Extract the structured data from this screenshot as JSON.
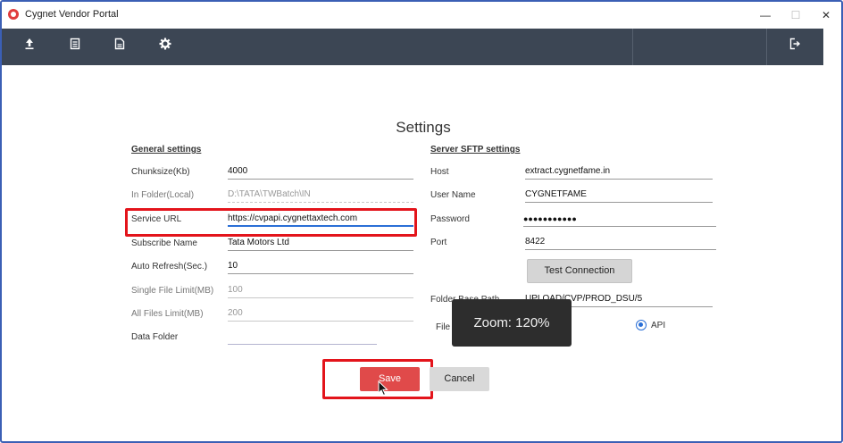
{
  "window": {
    "title": "Cygnet Vendor Portal",
    "minimize_glyph": "—",
    "maximize_glyph": "☐",
    "close_glyph": "✕"
  },
  "toolbar": {
    "buttons": [
      {
        "icon": "upload-icon"
      },
      {
        "icon": "list-document-icon"
      },
      {
        "icon": "file-document-icon"
      },
      {
        "icon": "gear-icon"
      },
      {
        "icon": "logout-icon"
      }
    ],
    "background": "#3c4654"
  },
  "settings": {
    "title": "Settings",
    "general": {
      "heading": "General settings",
      "chunksize_label": "Chunksize(Kb)",
      "chunksize_value": "4000",
      "in_folder_label": "In Folder(Local)",
      "in_folder_value": "D:\\TATA\\TWBatch\\IN",
      "service_url_label": "Service URL",
      "service_url_value": "https://cvpapi.cygnettaxtech.com",
      "subscribe_name_label": "Subscribe Name",
      "subscribe_name_value": "Tata Motors Ltd",
      "auto_refresh_label": "Auto Refresh(Sec.)",
      "auto_refresh_value": "10",
      "single_file_limit_label": "Single File Limit(MB)",
      "single_file_limit_value": "100",
      "all_files_limit_label": "All Files Limit(MB)",
      "all_files_limit_value": "200",
      "data_folder_label": "Data Folder",
      "data_folder_value": ""
    },
    "sftp": {
      "heading": "Server SFTP settings",
      "host_label": "Host",
      "host_value": "extract.cygnetfame.in",
      "username_label": "User Name",
      "username_value": "CYGNETFAME",
      "password_label": "Password",
      "password_value": "●●●●●●●●●●●",
      "port_label": "Port",
      "port_value": "8422",
      "test_connection_label": "Test Connection",
      "folder_path_label_partial": "Folder Base Path",
      "folder_path_value_partial": "UPLOAD/CVP/PROD_DSU/5",
      "file_mode_label_partial": "File",
      "api_radio_label": "API",
      "api_selected": true
    },
    "save_label": "Save",
    "cancel_label": "Cancel"
  },
  "zoom_toast": {
    "text": "Zoom: 120%"
  },
  "colors": {
    "highlight_red": "#e3141b",
    "save_red": "#e04a4a",
    "focus_blue": "#2a6fd6"
  }
}
